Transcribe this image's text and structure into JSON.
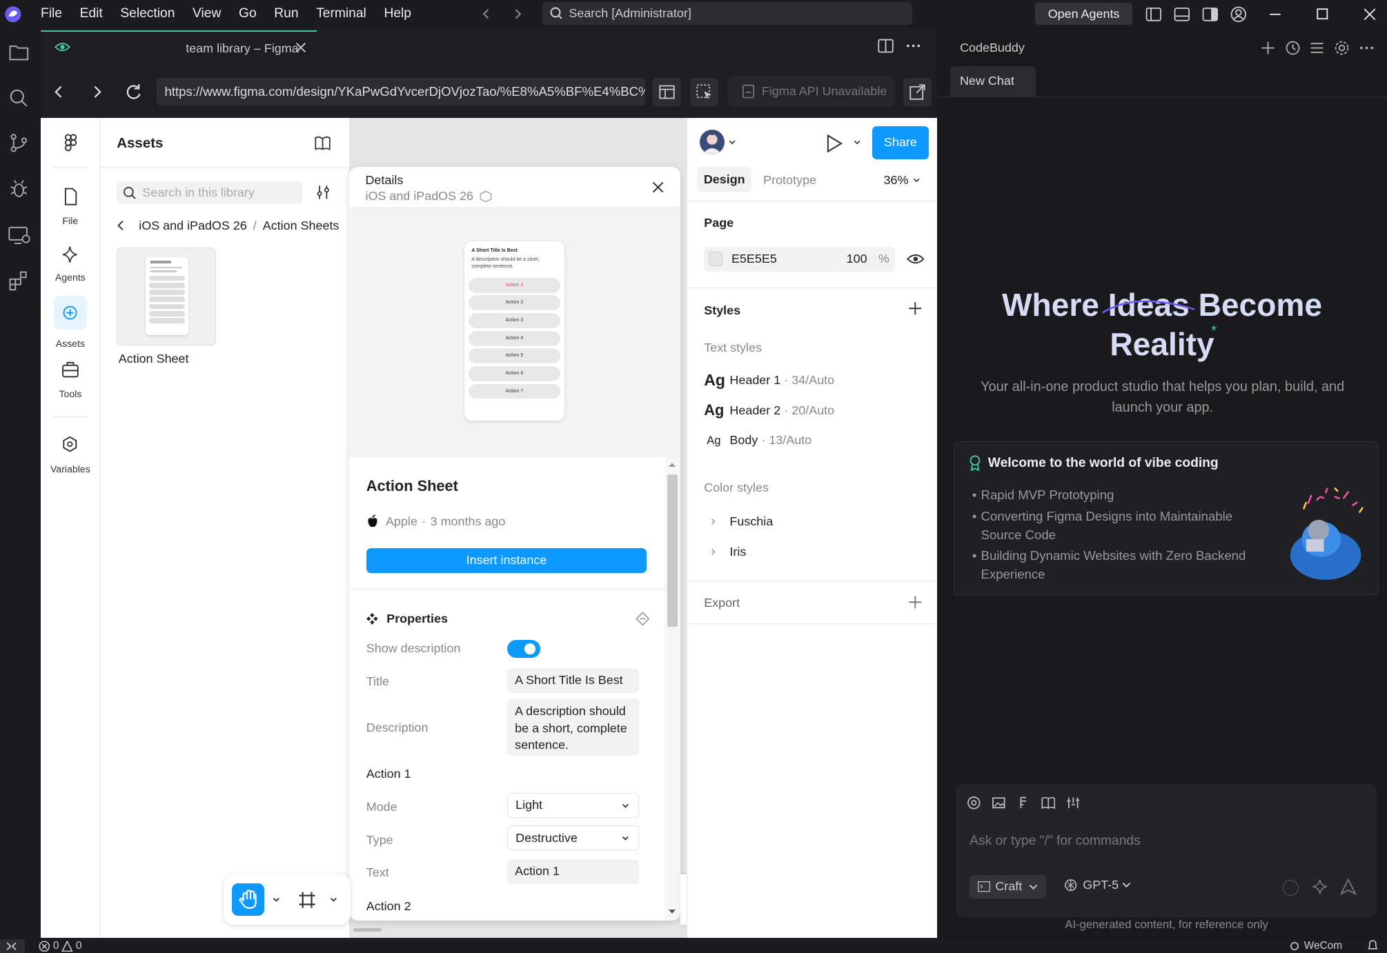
{
  "titlebar": {
    "menu": [
      "File",
      "Edit",
      "Selection",
      "View",
      "Go",
      "Run",
      "Terminal",
      "Help"
    ],
    "search_text": "Search [Administrator]",
    "open_agents_label": "Open Agents"
  },
  "tab": {
    "title": "team library – Figma"
  },
  "browser": {
    "url": "https://www.figma.com/design/YKaPwGdYvcerDjOVjozTao/%E8%A5%BF%E4%BC%AF%E4%BA%9A",
    "api_label": "Figma API Unavailable"
  },
  "figma_nav": {
    "items": [
      {
        "label": "File",
        "icon": "file-icon"
      },
      {
        "label": "Agents",
        "icon": "sparkle-icon"
      },
      {
        "label": "Assets",
        "icon": "assets-icon"
      },
      {
        "label": "Tools",
        "icon": "toolbox-icon"
      },
      {
        "label": "Variables",
        "icon": "variables-icon"
      }
    ]
  },
  "assets": {
    "title": "Assets",
    "search_placeholder": "Search in this library",
    "breadcrumb_parent": "iOS and iPadOS 26",
    "breadcrumb_separator": "/",
    "breadcrumb_current": "Action Sheets",
    "card_label": "Action Sheet"
  },
  "details": {
    "header": "Details",
    "subheader": "iOS and iPadOS 26",
    "preview": {
      "title": "A Short Title Is Best",
      "desc": "A description should be a short, complete sentence.",
      "actions": [
        "Action 1",
        "Action 2",
        "Action 3",
        "Action 4",
        "Action 5",
        "Action 6",
        "Action 7"
      ]
    },
    "name": "Action Sheet",
    "author": "Apple",
    "age": "3 months ago",
    "meta_separator": "·",
    "insert_label": "Insert instance",
    "properties_label": "Properties",
    "props": {
      "show_description_label": "Show description",
      "show_description_value": true,
      "title_label": "Title",
      "title_value": "A Short Title Is Best",
      "description_label": "Description",
      "description_value": "A description should be a short, complete sentence.",
      "action1_heading": "Action 1",
      "mode_label": "Mode",
      "mode_value": "Light",
      "type_label": "Type",
      "type_value": "Destructive",
      "text_label": "Text",
      "text_value": "Action 1",
      "action2_heading": "Action 2"
    }
  },
  "right": {
    "share_label": "Share",
    "tab_design": "Design",
    "tab_prototype": "Prototype",
    "zoom": "36%",
    "page_label": "Page",
    "page_color": "E5E5E5",
    "page_opacity": "100",
    "page_opacity_unit": "%",
    "styles_label": "Styles",
    "text_styles_label": "Text styles",
    "text_styles": [
      {
        "sample": "Ag",
        "name": "Header 1",
        "spec": "· 34/Auto"
      },
      {
        "sample": "Ag",
        "name": "Header 2",
        "spec": "· 20/Auto"
      },
      {
        "sample": "Ag",
        "name": "Body",
        "spec": "· 13/Auto"
      }
    ],
    "color_styles_label": "Color styles",
    "color_styles": [
      "Fuschia",
      "Iris"
    ],
    "export_label": "Export"
  },
  "codebuddy": {
    "title": "CodeBuddy",
    "new_chat": "New Chat",
    "hero_title_1": "Where Ideas Become",
    "hero_title_2": "Reality",
    "hero_subtitle": "Your all-in-one product studio that helps you plan, build, and launch your app.",
    "welcome_title": "Welcome to the world of vibe coding",
    "bullets": [
      "Rapid MVP Prototyping",
      "Converting Figma Designs into Maintainable Source Code",
      "Building Dynamic Websites with Zero Backend Experience"
    ],
    "input_placeholder": "Ask or type \"/\" for commands",
    "mode_label": "Craft",
    "model_label": "GPT-5",
    "disclaimer": "AI-generated content, for reference only"
  },
  "status": {
    "errors": "0",
    "warnings": "0",
    "wecom": "WeCom"
  },
  "colors": {
    "accent_green": "#3ec8a6",
    "figma_blue": "#0d99ff",
    "destructive_red": "#e5484d"
  }
}
